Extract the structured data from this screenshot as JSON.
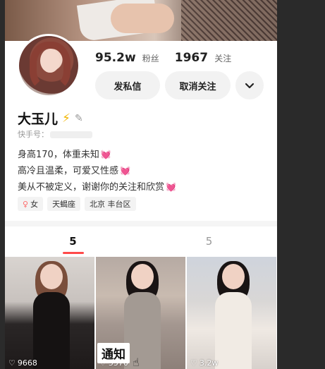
{
  "profile": {
    "name": "大玉儿",
    "name_badge": "⚡",
    "id_label": "快手号：",
    "fans_count": "95.2w",
    "fans_label": "粉丝",
    "following_count": "1967",
    "following_label": "关注"
  },
  "actions": {
    "message_label": "发私信",
    "unfollow_label": "取消关注",
    "more_icon": "chevron-down-icon"
  },
  "bio": {
    "line1": "身高170，体重未知",
    "line2": "高冷且温柔，可爱又性感",
    "line3": "美从不被定义，谢谢你的关注和欣赏",
    "emoji": "💓"
  },
  "tags": {
    "gender": "女",
    "zodiac": "天蝎座",
    "location": "北京 丰台区"
  },
  "tabs": [
    {
      "label": "5",
      "active": true
    },
    {
      "label": "5",
      "active": false
    }
  ],
  "videos": [
    {
      "likes": "9668"
    },
    {
      "likes": "5570",
      "overlay_label": "通知"
    },
    {
      "likes": "3.2w"
    }
  ],
  "colors": {
    "accent": "#ff4a4a",
    "heart": "#ff5fa8",
    "bolt": "#f2b705"
  }
}
